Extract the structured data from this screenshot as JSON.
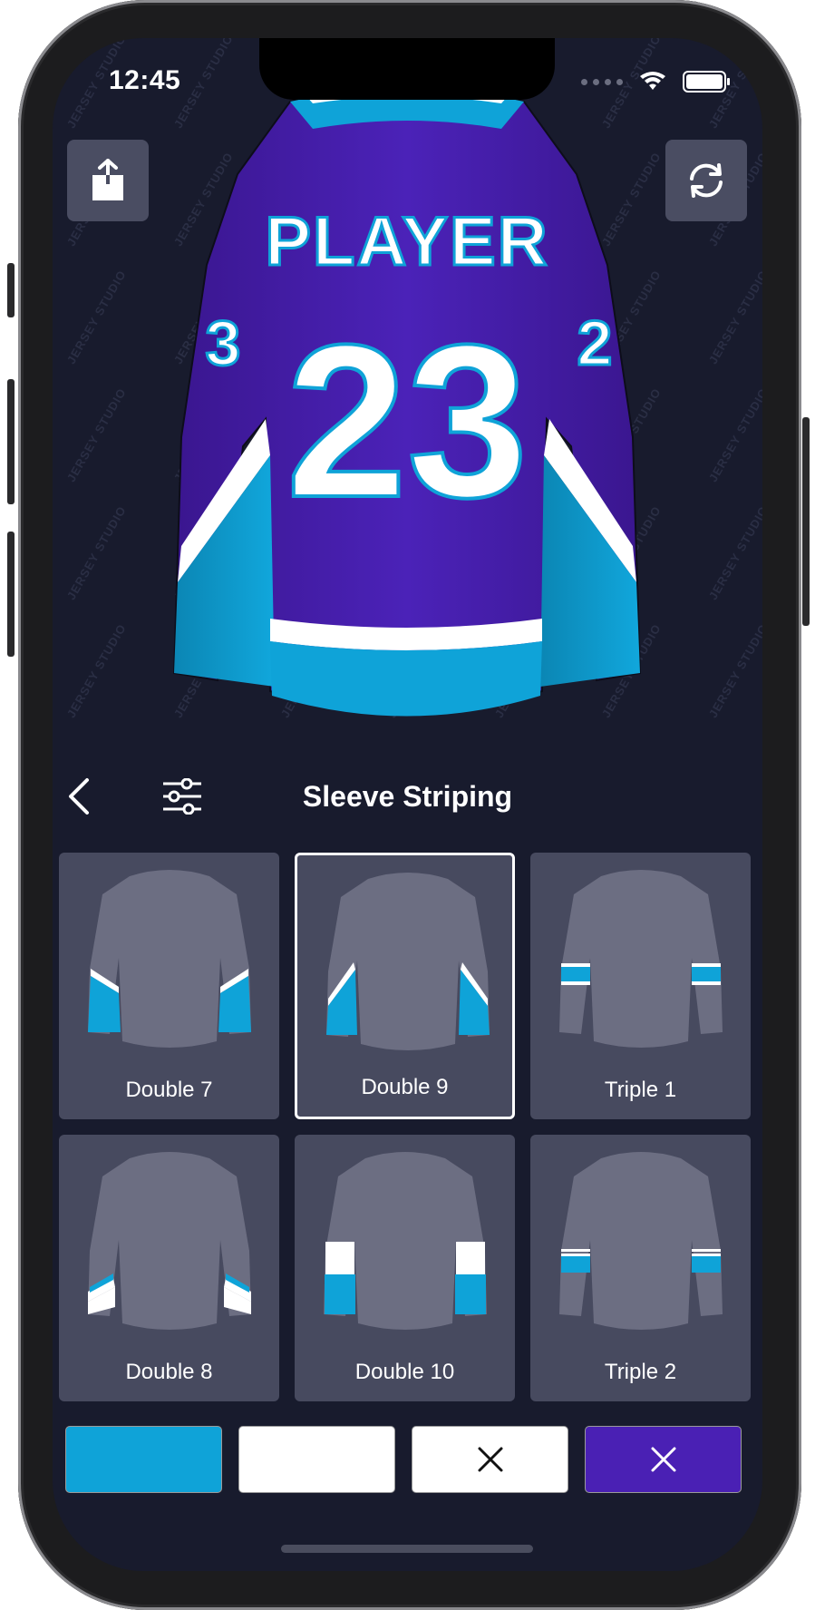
{
  "status_bar": {
    "time": "12:45",
    "icons": [
      "cellular-icon",
      "wifi-icon",
      "battery-icon"
    ]
  },
  "header": {
    "share_icon": "share-icon",
    "rotate_icon": "rotate-icon"
  },
  "jersey": {
    "name": "PLAYER",
    "number": "23",
    "sleeve_number_left": "3",
    "sleeve_number_right": "2",
    "watermark": "JERSEY STUDIO",
    "colors": {
      "body": "#4a20b4",
      "accent": "#0fa3d8",
      "stripe": "#ffffff"
    }
  },
  "toolbar": {
    "back_icon": "chevron-left-icon",
    "filter_icon": "sliders-icon",
    "title": "Sleeve Striping"
  },
  "styles": [
    {
      "label": "Double 7",
      "selected": false
    },
    {
      "label": "Double 9",
      "selected": true
    },
    {
      "label": "Triple 1",
      "selected": false
    },
    {
      "label": "Double 8",
      "selected": false
    },
    {
      "label": "Double 10",
      "selected": false
    },
    {
      "label": "Triple 2",
      "selected": false
    }
  ],
  "color_swatches": [
    {
      "color": "#0fa3d8",
      "state": "filled"
    },
    {
      "color": "#ffffff",
      "state": "filled"
    },
    {
      "color": "#ffffff",
      "state": "removed"
    },
    {
      "color": "#4a20b4",
      "state": "removed"
    }
  ]
}
